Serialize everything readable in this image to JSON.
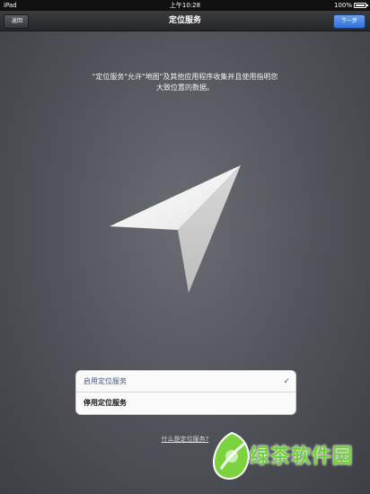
{
  "status_bar": {
    "carrier": "iPad",
    "time": "上午10:28",
    "battery": "100%",
    "battery_level": 1.0
  },
  "nav": {
    "title": "定位服务",
    "back_label": "返回",
    "next_label": "下一步"
  },
  "description": "\"定位服务\"允许\"地图\"及其他应用程序收集并且使用指明您大致位置的数据。",
  "options": [
    {
      "label": "启用定位服务",
      "selected": true
    },
    {
      "label": "停用定位服务",
      "selected": false
    }
  ],
  "help_link": "什么是定位服务?",
  "watermark": {
    "text": "绿茶软件园",
    "icon": "leaf-logo"
  },
  "colors": {
    "accent": "#2f6fd8",
    "check": "#3e5883",
    "watermark": "#72d03b"
  }
}
